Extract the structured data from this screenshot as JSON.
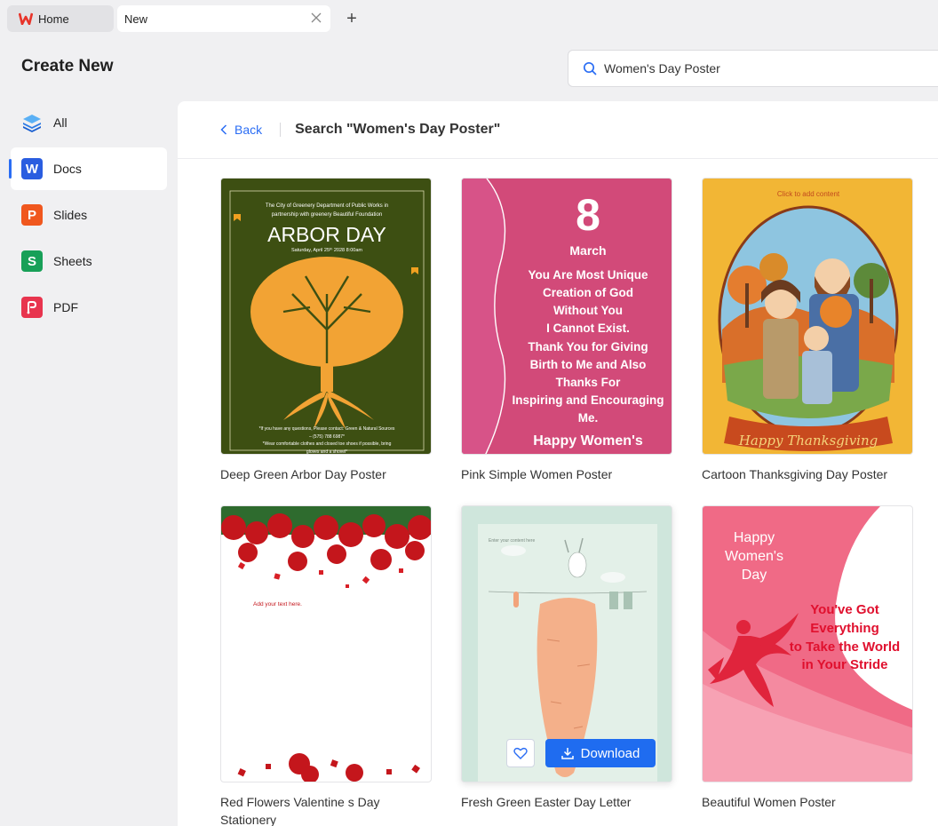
{
  "tabs": {
    "home_label": "Home",
    "new_label": "New"
  },
  "header": {
    "title": "Create New",
    "search_value": "Women's Day Poster"
  },
  "sidebar": {
    "items": [
      {
        "label": "All"
      },
      {
        "label": "Docs",
        "icon_letter": "W"
      },
      {
        "label": "Slides",
        "icon_letter": "P"
      },
      {
        "label": "Sheets",
        "icon_letter": "S"
      },
      {
        "label": "PDF"
      }
    ]
  },
  "main": {
    "back_label": "Back",
    "search_title": "Search \"Women's Day Poster\"",
    "download_label": "Download",
    "templates": [
      {
        "title": "Deep Green Arbor Day Poster",
        "poster": {
          "line1": "The City of  Greenery Department of Public Works in",
          "line2": "partnership with greenery Beautiful Foundation",
          "heading": "ARBOR DAY",
          "date": "Saturday, April 25ᵗʰ 2028  8:00am",
          "foot1": "*If you have any questions, Please contact: Green & Natural Sources",
          "foot2": "– (575) 788 6987*",
          "foot3": "*Wear comfortable clothes and closed toe shoes if possible, bring",
          "foot4": "gloves and a shovel*"
        }
      },
      {
        "title": "Pink Simple Women Poster",
        "poster": {
          "number": "8",
          "month": "March",
          "lines": [
            "You Are Most Unique",
            "Creation of God",
            "Without You",
            "I Cannot Exist.",
            "Thank You for Giving",
            "Birth to Me and Also",
            "Thanks For",
            "Inspiring and Encouraging",
            "Me."
          ],
          "footer": "Happy Women's"
        }
      },
      {
        "title": "Cartoon Thanksgiving Day Poster",
        "poster": {
          "top": "Click to add content",
          "banner": "Happy Thanksgiving"
        }
      },
      {
        "title": "Red Flowers Valentine s Day Stationery",
        "poster": {
          "text": "Add your text here."
        }
      },
      {
        "title": "Fresh Green Easter Day Letter",
        "poster": {
          "text": "Enter your content here"
        }
      },
      {
        "title": "Beautiful Women Poster",
        "poster": {
          "l1": "Happy",
          "l2": "Women's",
          "l3": "Day",
          "r1": "You've Got",
          "r2": "Everything",
          "r3": "to Take the World",
          "r4": "in Your Stride"
        }
      }
    ]
  },
  "colors": {
    "accent": "#1f6cf0",
    "docs": "#2a5de0",
    "slides": "#f0571e",
    "sheets": "#18a058",
    "pdf": "#e8344e"
  }
}
